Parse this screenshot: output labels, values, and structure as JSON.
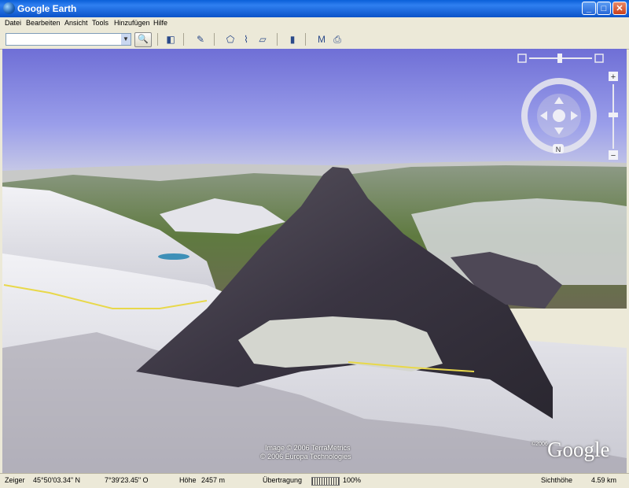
{
  "window": {
    "title": "Google Earth",
    "controls": [
      "_",
      "□",
      "✕"
    ]
  },
  "menu": [
    "Datei",
    "Bearbeiten",
    "Ansicht",
    "Tools",
    "Hinzufügen",
    "Hilfe"
  ],
  "search": {
    "value": "",
    "placeholder": ""
  },
  "toolbar": {
    "go_icon": "magnifier-icon",
    "icons": [
      "sidebar-toggle-icon",
      "placemark-add-icon",
      "polygon-add-icon",
      "path-add-icon",
      "image-overlay-add-icon",
      "ruler-icon",
      "email-icon",
      "print-icon"
    ]
  },
  "nav": {
    "north_label": "N",
    "zoom_in": "+",
    "zoom_out": "−"
  },
  "attribution": {
    "line1": "Image © 2006 TerraMetrics",
    "line2": "© 2006 Europa Technologies",
    "logo_year": "©2006",
    "logo_text": "Google"
  },
  "status": {
    "pointer_label": "Zeiger",
    "lat": "45°50'03.34\"  N",
    "lon": "7°39'23.45\"  O",
    "height_label": "Höhe",
    "height_value": "2457 m",
    "streaming_label": "Übertragung",
    "streaming_value": "100%",
    "eye_label": "Sichthöhe",
    "eye_value": "4.59 km"
  }
}
